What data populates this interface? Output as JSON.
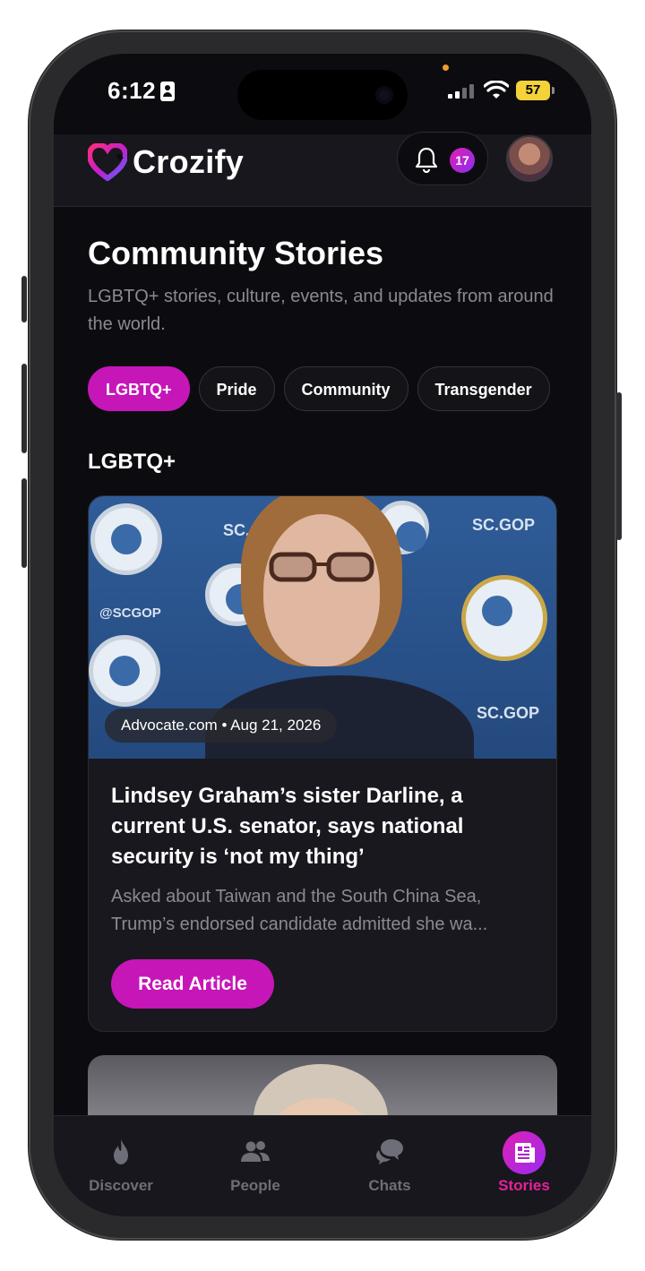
{
  "status_bar": {
    "time": "6:12",
    "battery": "57"
  },
  "header": {
    "app_name": "Crozify",
    "notification_count": "17"
  },
  "page": {
    "title": "Community Stories",
    "subtitle": "LGBTQ+ stories, culture, events, and updates from around the world."
  },
  "filters": [
    "LGBTQ+",
    "Pride",
    "Community",
    "Transgender"
  ],
  "selected_filter": "LGBTQ+",
  "section_label": "LGBTQ+",
  "articles": [
    {
      "source_date": "Advocate.com • Aug 21, 2026",
      "title": "Lindsey Graham’s sister Darline, a current U.S. senator, says national security is ‘not my thing’",
      "excerpt": "Asked about Taiwan and the South China Sea, Trump’s endorsed candidate admitted she wa...",
      "button_label": "Read Article"
    }
  ],
  "tabs": [
    {
      "label": "Discover",
      "icon": "flame-icon"
    },
    {
      "label": "People",
      "icon": "people-icon"
    },
    {
      "label": "Chats",
      "icon": "chat-bubbles-icon"
    },
    {
      "label": "Stories",
      "icon": "newspaper-icon"
    }
  ],
  "active_tab": "Stories",
  "colors": {
    "accent": "#c616b8",
    "active_tab_label": "#e8209a",
    "background": "#0c0c10"
  }
}
